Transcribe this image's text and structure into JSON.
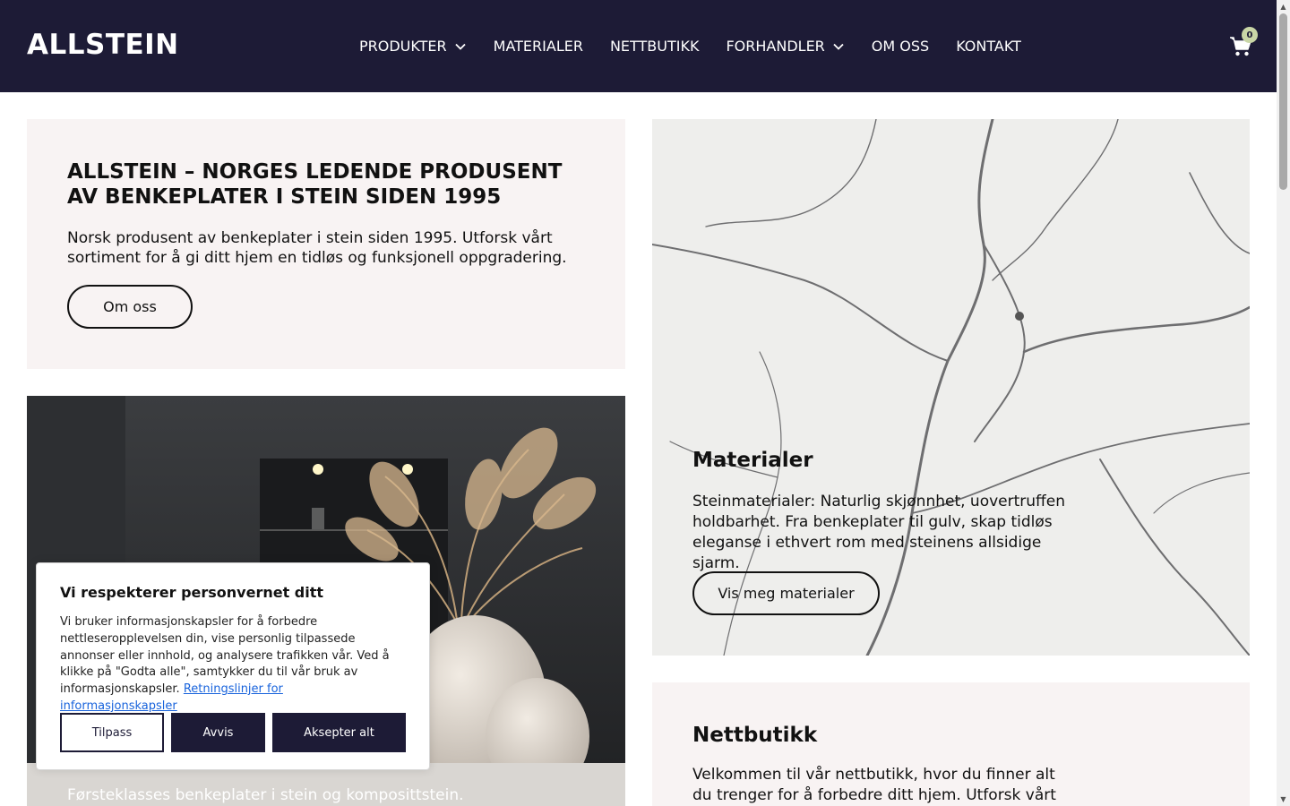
{
  "brand": {
    "logo": "ALLSTEIN",
    "primary_color": "#1d1b36",
    "card_bg": "#f8f3f3"
  },
  "nav": {
    "items": [
      {
        "label": "PRODUKTER",
        "has_dropdown": true
      },
      {
        "label": "MATERIALER",
        "has_dropdown": false
      },
      {
        "label": "NETTBUTIKK",
        "has_dropdown": false
      },
      {
        "label": "FORHANDLER",
        "has_dropdown": true
      },
      {
        "label": "OM OSS",
        "has_dropdown": false
      },
      {
        "label": "KONTAKT",
        "has_dropdown": false
      }
    ],
    "cart_icon": "shopping-cart-icon",
    "cart_count": "0"
  },
  "intro": {
    "title": "ALLSTEIN – NORGES LEDENDE PRODUSENT AV BENKEPLATER I STEIN SIDEN 1995",
    "text": "Norsk produsent av benkeplater i stein siden 1995. Utforsk vårt sortiment for å gi ditt hjem en tidløs og funksjonell oppgradering.",
    "button": "Om oss"
  },
  "materialer": {
    "title": "Materialer",
    "text": "Steinmaterialer: Naturlig skjønnhet, uovertruffen holdbarhet. Fra benkeplater til gulv, skap tidløs eleganse i ethvert rom med steinens allsidige sjarm.",
    "button": "Vis meg materialer"
  },
  "kitchen": {
    "text": "Førsteklasses benkeplater i stein og kompositt­stein."
  },
  "nettbutikk": {
    "title": "Nettbutikk",
    "text": "Velkommen til vår nettbutikk, hvor du finner alt du trenger for å forbedre ditt hjem. Utforsk vårt"
  },
  "cookie": {
    "title": "Vi respekterer personvernet ditt",
    "text": "Vi bruker informasjonskapsler for å forbedre nettleseropplevelsen din, vise personlig tilpassede annonser eller innhold, og analysere trafikken vår. Ved å klikke på \"Godta alle\", samtykker du til vår bruk av informasjonskapsler.",
    "link": "Retningslinjer for informasjonskapsler",
    "buttons": {
      "customize": "Tilpass",
      "reject": "Avvis",
      "accept": "Aksepter alt"
    }
  }
}
